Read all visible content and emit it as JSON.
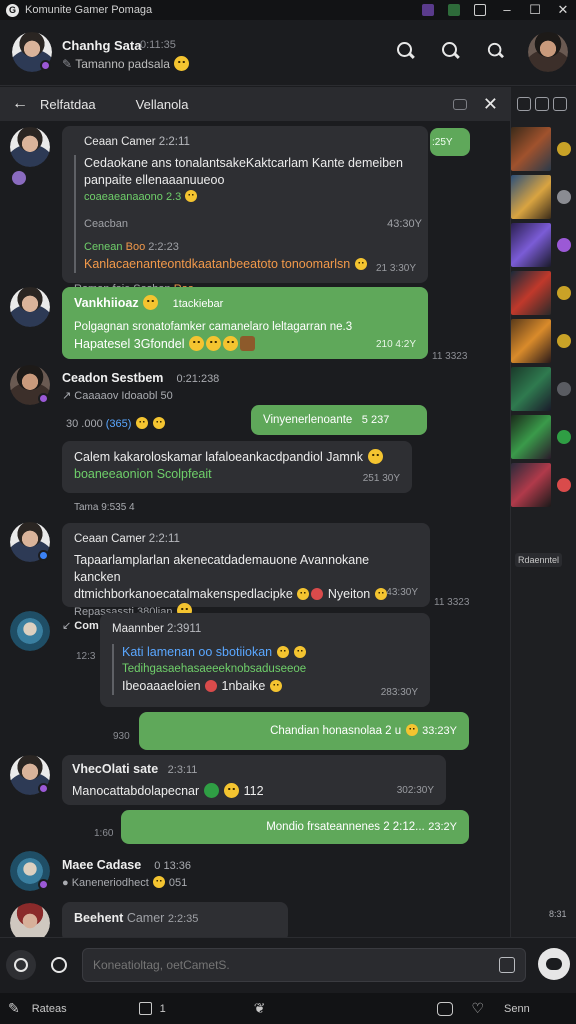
{
  "window": {
    "title": "Komunite Gamer Pomaga"
  },
  "header": {
    "name": "Chanhg Sata",
    "time": "0:11:35",
    "status": "Tamanno padsala"
  },
  "tabs": [
    {
      "label": "Relfatdaa"
    },
    {
      "label": "Vellanola"
    }
  ],
  "messages": {
    "m1": {
      "sender": "Ceaan Camer",
      "time": "2:2:11",
      "line1": "Cedaokane ans tonalantsakeKaktcarlam Kante demeiben",
      "line2": "panpaite ellenaaanuueoo",
      "line3": "coaeaeanaaono 2.3",
      "line4": "Ceacban",
      "ts1": "43:30Y",
      "quote_sender": "Cenean",
      "quote_tag": "Boo",
      "quote_time": "2:2:23",
      "quote_text": "Kanlacaenanteontdkaatanbeeatoto tonoomarlsn",
      "footer": "Raman foie Soshan",
      "footer_tag": "Roo",
      "ts": "21 3:30Y"
    },
    "m2": {
      "name": "Vankhiioaz",
      "tag": "1tackiebar",
      "line1": "Polgagnan sronatofamker camanelaro leltagarran ne.3",
      "line2": "Hapatesel 3Gfondel",
      "ts": "210 4:2Y",
      "side_time": "11 3323"
    },
    "m3": {
      "name": "Ceadon Sestbem",
      "time": "0:21:238",
      "sub": "Caaaaov Idoaobl 50",
      "sub2": "30 .000",
      "sub3": "(365)"
    },
    "m4": {
      "text": "Vinyenerlenoante",
      "ts": "5 237"
    },
    "m5": {
      "line1": "Calem kakaroloskamar lafaloeankacdpandiol Jamnk",
      "line2": "boaneeaonion Scolpfeait",
      "ts": "251 30Y",
      "footer": "Tama 9:535 4"
    },
    "m6": {
      "sender": "Ceaan Camer",
      "time": "2:2:11",
      "line1": "Tapaarlamplarlan akenecatdademauone Avannokane kancken",
      "line2": "dtmichborkanoecatalmakenspedlacipke",
      "line2b": "Nyeiton",
      "line3": "Repassassti 380lian",
      "ts": "43:30Y",
      "side_time": "11 3323"
    },
    "m7": {
      "label": "Com",
      "side_time": "12:3",
      "sender": "Maannber",
      "time": "2:3911",
      "line1": "Kati lamenan oo sbotiiokan",
      "line2": "Tedihgasaehasaeeeknobsaduseeoe",
      "line3": "Ibeoaaaeloien",
      "line3b": "1nbaike",
      "ts": "283:30Y"
    },
    "m8": {
      "side": "930",
      "text": "Chandian honasnolaa 2 u",
      "ts": "33:23Y"
    },
    "m9": {
      "name": "VhecOlati sate",
      "time": "2:3:11",
      "line1": "Manocattabdolapecnar",
      "tail": "112",
      "ts": "302:30Y"
    },
    "m10": {
      "side": "1:60",
      "text": "Mondio frsateannenes 2 2:12...",
      "ts": "23:2Y"
    },
    "m11": {
      "name": "Maee Cadase",
      "time": "0 13:36",
      "sub": "Kaneneriodhect",
      "sub2": "051"
    },
    "m12": {
      "name": "Beehent",
      "sender": "Camer",
      "time": "2:2:35"
    }
  },
  "side_panel": {
    "label": "Rdaenntel",
    "num": "8:31"
  },
  "composer": {
    "placeholder": "Koneatioltag, oetCametS."
  },
  "bottom_bar": {
    "left_label": "Rateas",
    "page": "1",
    "right_label": "Senn"
  }
}
